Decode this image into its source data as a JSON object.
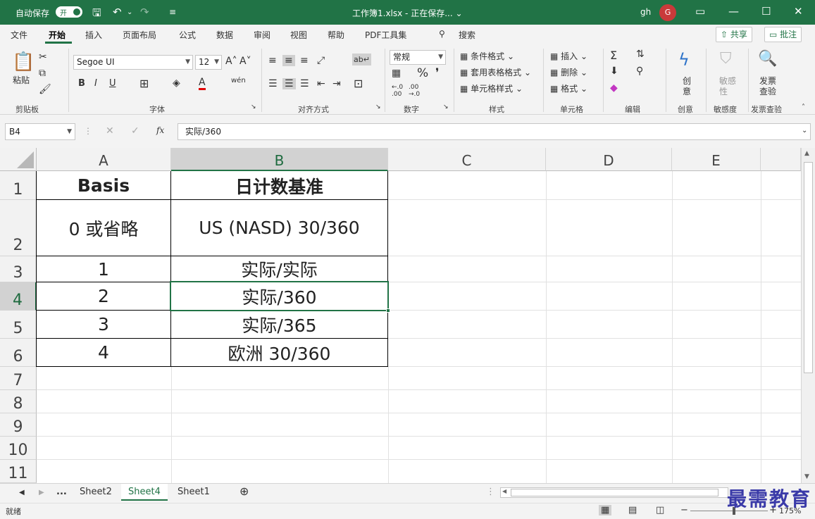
{
  "titlebar": {
    "autosave_label": "自动保存",
    "autosave_toggle": "开",
    "doc_title": "工作簿1.xlsx - 正在保存... ⌄",
    "user": "gh",
    "avatar_initial": "G"
  },
  "tabs": [
    "文件",
    "开始",
    "插入",
    "页面布局",
    "公式",
    "数据",
    "审阅",
    "视图",
    "帮助",
    "PDF工具集"
  ],
  "search_label": "搜索",
  "share_label": "共享",
  "comments_label": "批注",
  "ribbon": {
    "clipboard": {
      "paste": "粘贴",
      "group": "剪贴板"
    },
    "font": {
      "name": "Segoe UI",
      "size": "12",
      "group": "字体"
    },
    "alignment": {
      "group": "对齐方式"
    },
    "number": {
      "format": "常规",
      "group": "数字"
    },
    "styles": {
      "cond_format": "条件格式",
      "table_format": "套用表格格式",
      "cell_styles": "单元格样式",
      "group": "样式"
    },
    "cells": {
      "insert": "插入",
      "delete": "删除",
      "format": "格式",
      "group": "单元格"
    },
    "editing": {
      "group": "编辑"
    },
    "creative": {
      "label1": "创",
      "label2": "意",
      "group": "创意"
    },
    "sensitivity": {
      "label1": "敏感",
      "label2": "性",
      "group": "敏感度"
    },
    "invoice": {
      "label1": "发票",
      "label2": "查验",
      "group": "发票查验"
    }
  },
  "formula_bar": {
    "name_box": "B4",
    "formula": "实际/360",
    "fx": "fx"
  },
  "columns": [
    "A",
    "B",
    "C",
    "D",
    "E"
  ],
  "rows": [
    "1",
    "2",
    "3",
    "4",
    "5",
    "6",
    "7",
    "8",
    "9",
    "10",
    "11"
  ],
  "cells": {
    "A1": "Basis",
    "B1": "日计数基准",
    "A2": "0 或省略",
    "B2": "US (NASD) 30/360",
    "A3": "1",
    "B3": "实际/实际",
    "A4": "2",
    "B4": "实际/360",
    "A5": "3",
    "B5": "实际/365",
    "A6": "4",
    "B6": "欧洲 30/360"
  },
  "sheets": [
    "Sheet2",
    "Sheet4",
    "Sheet1"
  ],
  "sheet_ellipsis": "...",
  "status": {
    "ready": "就绪",
    "zoom": "175%"
  },
  "watermark": "最需教育",
  "colors": {
    "accent": "#217346",
    "selection": "#217346"
  }
}
